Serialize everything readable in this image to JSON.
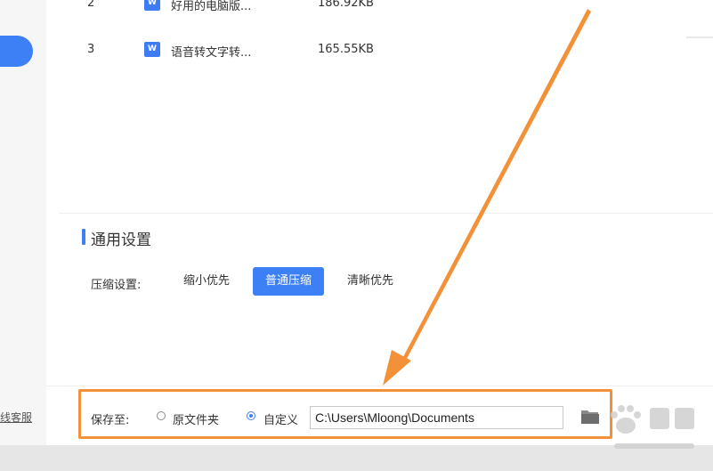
{
  "files": [
    {
      "index": "2",
      "badge": "W",
      "name": "好用的电脑版...",
      "size": "186.92KB"
    },
    {
      "index": "3",
      "badge": "W",
      "name": "语音转文字转...",
      "size": "165.55KB"
    }
  ],
  "sidebar": {
    "link_label": "线客服"
  },
  "settings": {
    "section_title": "通用设置",
    "compress_label": "压缩设置:",
    "options": [
      {
        "label": "缩小优先",
        "selected": false
      },
      {
        "label": "普通压缩",
        "selected": true
      },
      {
        "label": "清晰优先",
        "selected": false
      }
    ]
  },
  "save": {
    "label": "保存至:",
    "radio_original": "原文件夹",
    "radio_custom": "自定义",
    "selected": "自定义",
    "path_value": "C:\\Users\\Mloong\\Documents"
  },
  "icons": {
    "file": "word-doc-icon",
    "browse": "folder-icon",
    "watermark": "baidu-jingyan-watermark-icon"
  },
  "colors": {
    "accent": "#3d7ff5",
    "highlight": "#f39139"
  }
}
